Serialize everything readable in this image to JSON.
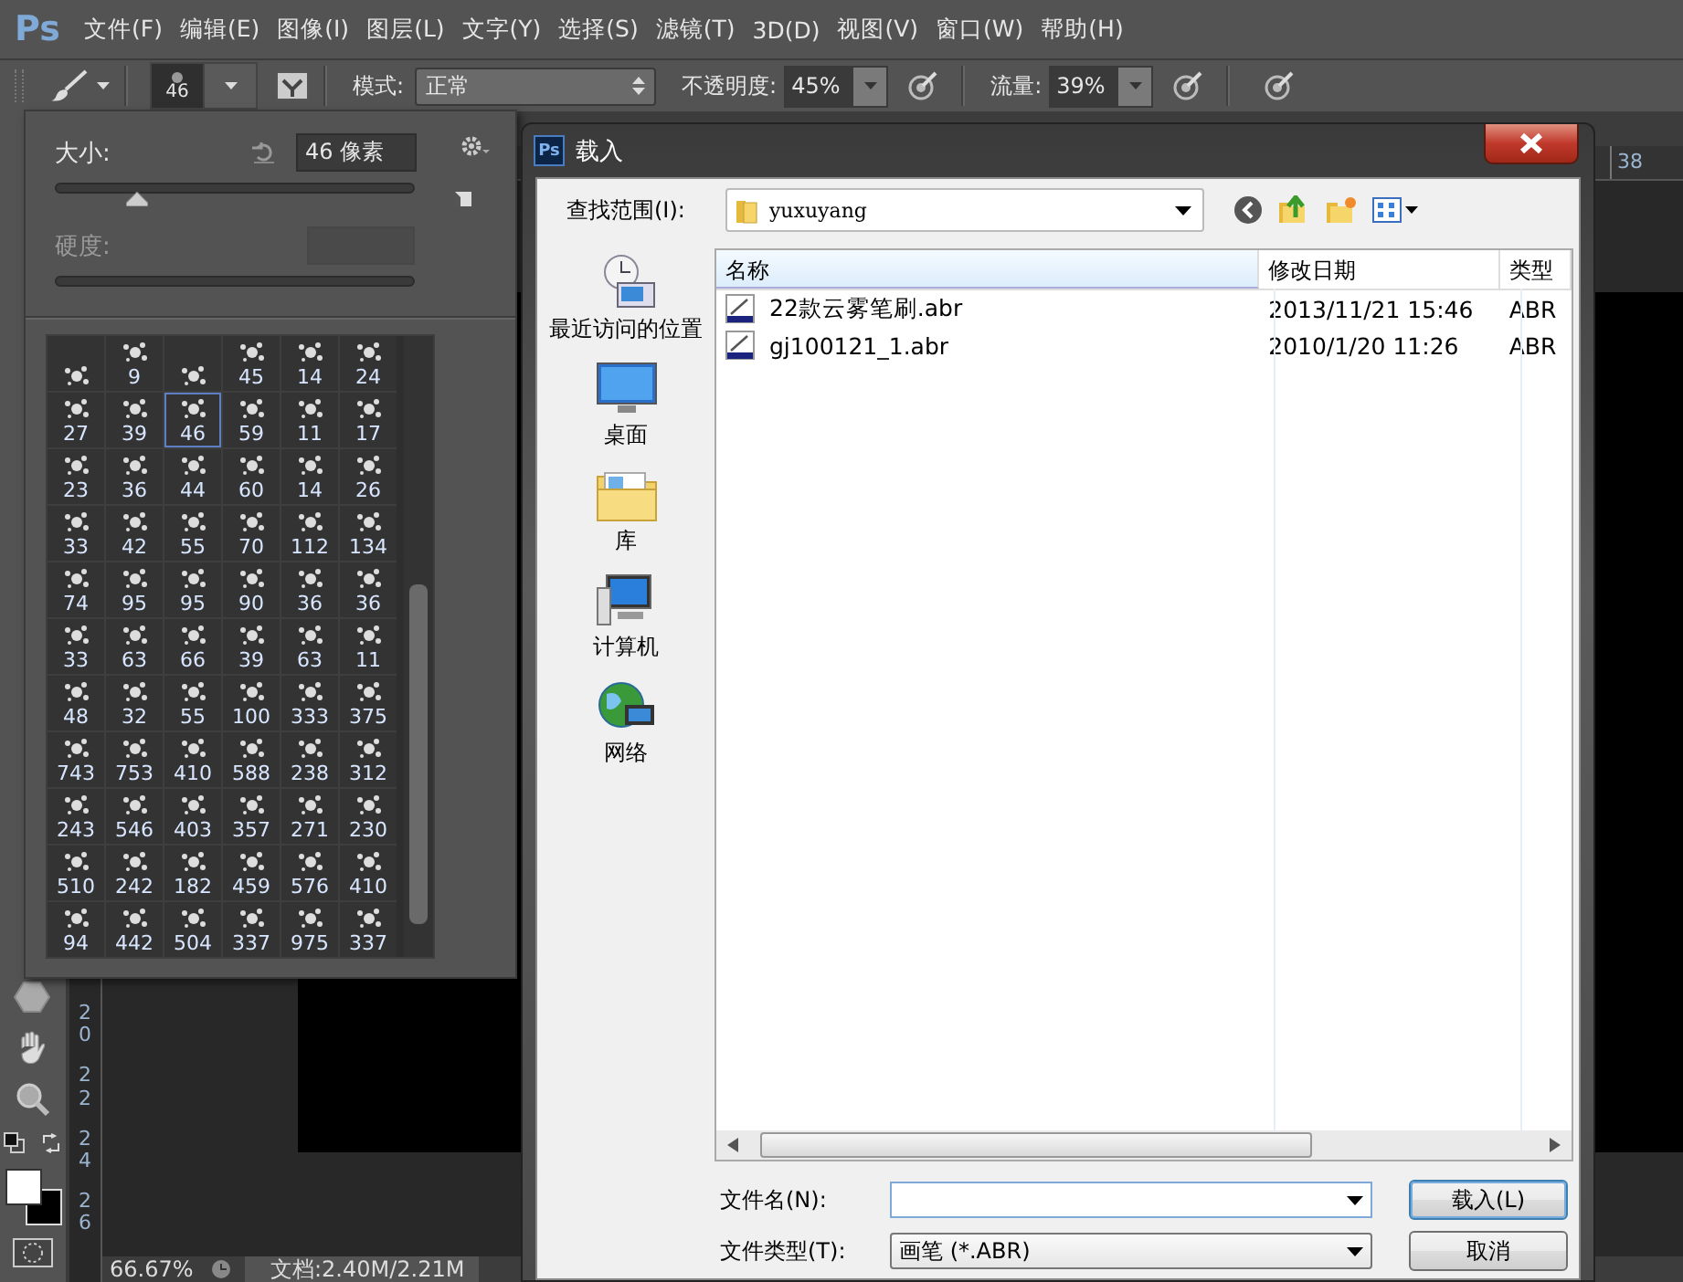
{
  "menu_bar": {
    "logo": "Ps",
    "items": [
      "文件(F)",
      "编辑(E)",
      "图像(I)",
      "图层(L)",
      "文字(Y)",
      "选择(S)",
      "滤镜(T)",
      "3D(D)",
      "视图(V)",
      "窗口(W)",
      "帮助(H)"
    ]
  },
  "options_bar": {
    "brush_size": "46",
    "mode_label": "模式:",
    "mode": "正常",
    "opacity_label": "不透明度:",
    "opacity": "45%",
    "flow_label": "流量:",
    "flow": "39%"
  },
  "brush_panel": {
    "size_label": "大小:",
    "size_value": "46 像素",
    "size_slider": {
      "level": 0.23
    },
    "hardness_label": "硬度:",
    "hardness_disabled": true,
    "brushes": [
      {
        "selected": false
      },
      {
        "size": "9",
        "selected": false
      },
      {
        "selected": false
      },
      {
        "size": "45",
        "selected": false
      },
      {
        "size": "14",
        "selected": false
      },
      {
        "size": "24",
        "selected": false
      },
      {
        "size": "27",
        "selected": false
      },
      {
        "size": "39",
        "selected": false
      },
      {
        "size": "46",
        "selected": true
      },
      {
        "size": "59",
        "selected": false
      },
      {
        "size": "11",
        "selected": false
      },
      {
        "size": "17",
        "selected": false
      },
      {
        "size": "23",
        "selected": false
      },
      {
        "size": "36",
        "selected": false
      },
      {
        "size": "44",
        "selected": false
      },
      {
        "size": "60",
        "selected": false
      },
      {
        "size": "14",
        "selected": false
      },
      {
        "size": "26",
        "selected": false
      },
      {
        "size": "33",
        "selected": false
      },
      {
        "size": "42",
        "selected": false
      },
      {
        "size": "55",
        "selected": false
      },
      {
        "size": "70",
        "selected": false
      },
      {
        "size": "112",
        "selected": false
      },
      {
        "size": "134",
        "selected": false
      },
      {
        "size": "74",
        "selected": false
      },
      {
        "size": "95",
        "selected": false
      },
      {
        "size": "95",
        "selected": false
      },
      {
        "size": "90",
        "selected": false
      },
      {
        "size": "36",
        "selected": false
      },
      {
        "size": "36",
        "selected": false
      },
      {
        "size": "33",
        "selected": false
      },
      {
        "size": "63",
        "selected": false
      },
      {
        "size": "66",
        "selected": false
      },
      {
        "size": "39",
        "selected": false
      },
      {
        "size": "63",
        "selected": false
      },
      {
        "size": "11",
        "selected": false
      },
      {
        "size": "48",
        "selected": false
      },
      {
        "size": "32",
        "selected": false
      },
      {
        "size": "55",
        "selected": false
      },
      {
        "size": "100",
        "selected": false
      },
      {
        "size": "333",
        "selected": false
      },
      {
        "size": "375",
        "selected": false
      },
      {
        "size": "743",
        "selected": false
      },
      {
        "size": "753",
        "selected": false
      },
      {
        "size": "410",
        "selected": false
      },
      {
        "size": "588",
        "selected": false
      },
      {
        "size": "238",
        "selected": false
      },
      {
        "size": "312",
        "selected": false
      },
      {
        "size": "243",
        "selected": false
      },
      {
        "size": "546",
        "selected": false
      },
      {
        "size": "403",
        "selected": false
      },
      {
        "size": "357",
        "selected": false
      },
      {
        "size": "271",
        "selected": false
      },
      {
        "size": "230",
        "selected": false
      },
      {
        "size": "510",
        "selected": false
      },
      {
        "size": "242",
        "selected": false
      },
      {
        "size": "182",
        "selected": false
      },
      {
        "size": "459",
        "selected": false
      },
      {
        "size": "576",
        "selected": false
      },
      {
        "size": "410",
        "selected": false
      },
      {
        "size": "94",
        "selected": false
      },
      {
        "size": "442",
        "selected": false
      },
      {
        "size": "504",
        "selected": false
      },
      {
        "size": "337",
        "selected": false
      },
      {
        "size": "975",
        "selected": false
      },
      {
        "size": "337",
        "selected": false
      }
    ]
  },
  "vertical_ruler": [
    "20",
    "22",
    "24",
    "26"
  ],
  "top_ruler": "38",
  "status_bar": {
    "zoom": "66.67%",
    "document": "文档:2.40M/2.21M"
  },
  "dialog": {
    "icon_text": "Ps",
    "title": "载入",
    "look_in_label": "查找范围(I):",
    "folder": "yuxuyang",
    "places": [
      {
        "kind": "recent",
        "label": "最近访问的位置"
      },
      {
        "kind": "desktop",
        "label": "桌面"
      },
      {
        "kind": "library",
        "label": "库"
      },
      {
        "kind": "computer",
        "label": "计算机"
      },
      {
        "kind": "network",
        "label": "网络"
      }
    ],
    "columns": [
      "名称",
      "修改日期",
      "类型"
    ],
    "files": [
      {
        "name": "22款云雾笔刷.abr",
        "date": "2013/11/21 15:46",
        "type": "ABR"
      },
      {
        "name": "gj100121_1.abr",
        "date": "2010/1/20 11:26",
        "type": "ABR"
      }
    ],
    "filename_label": "文件名(N):",
    "filetype_label": "文件类型(T):",
    "filetype": "画笔 (*.ABR)",
    "buttons": [
      "载入(L)",
      "取消"
    ]
  }
}
